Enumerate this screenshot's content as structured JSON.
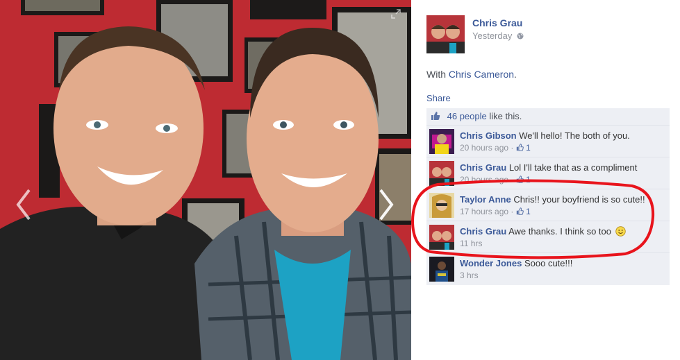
{
  "post": {
    "author": "Chris Grau",
    "time": "Yesterday",
    "with_prefix": "With",
    "with_name": "Chris Cameron",
    "with_suffix": ".",
    "share": "Share"
  },
  "likes": {
    "count_text": "46 people",
    "suffix": "like this."
  },
  "comments": [
    {
      "name": "Chris Gibson",
      "text": "We'll hello! The both of you.",
      "time": "20 hours ago",
      "likes": "1"
    },
    {
      "name": "Chris Grau",
      "text": "Lol I'll take that as a compliment",
      "time": "20 hours ago",
      "likes": "1"
    },
    {
      "name": "Taylor Anne",
      "text": "Chris!! your boyfriend is so cute!!",
      "time": "17 hours ago",
      "likes": "1"
    },
    {
      "name": "Chris Grau",
      "text": "Awe thanks. I think so too",
      "time": "11 hrs",
      "likes": ""
    },
    {
      "name": "Wonder Jones",
      "text": "Sooo cute!!!",
      "time": "3 hrs",
      "likes": ""
    }
  ],
  "colors": {
    "link_blue": "#3b5998",
    "comment_bg": "#edeff4",
    "annotation_red": "#e8141c"
  },
  "icons": [
    "chevron-left-icon",
    "chevron-right-icon",
    "expand-icon",
    "globe-icon",
    "thumbs-up-icon",
    "smiley-icon"
  ]
}
